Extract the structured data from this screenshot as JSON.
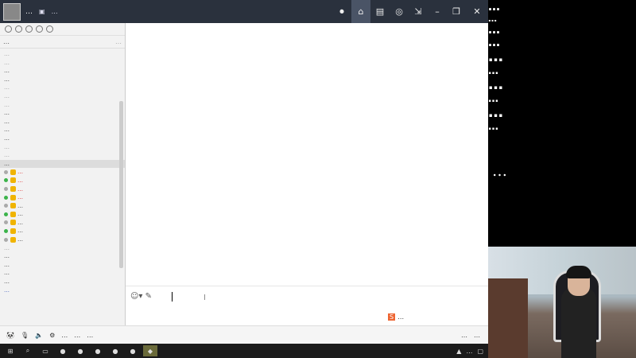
{
  "titlebar": {
    "user_name": "…",
    "user_id_icon": "id-card-icon",
    "followers": "…",
    "controls": [
      "home-icon",
      "layout-icon",
      "gamepad-icon",
      "shrink-icon",
      "minimize-icon",
      "restore-icon",
      "close-icon"
    ]
  },
  "left_panel": {
    "mode_label": "…",
    "mode_hint": "…",
    "lines": [
      {
        "text": "…",
        "style": "g"
      },
      {
        "text": "…",
        "style": "g"
      },
      {
        "text": "…",
        "style": "b"
      },
      {
        "text": "…",
        "style": "b"
      },
      {
        "text": "…",
        "style": "g"
      },
      {
        "text": "…",
        "style": "g"
      },
      {
        "text": "…",
        "style": "g"
      },
      {
        "text": "…",
        "style": "b"
      },
      {
        "text": "…",
        "style": "b"
      },
      {
        "text": "…",
        "style": "b"
      },
      {
        "text": "…",
        "style": "b"
      },
      {
        "text": "…",
        "style": "g"
      },
      {
        "text": "…",
        "style": "g"
      },
      {
        "text": "…",
        "style": "hl"
      },
      {
        "text": "…",
        "style": "red"
      },
      {
        "text": "…",
        "style": "red"
      },
      {
        "text": "…",
        "style": "red"
      },
      {
        "text": "…",
        "style": "red"
      },
      {
        "text": "…",
        "style": "b"
      },
      {
        "text": "…",
        "style": "b"
      },
      {
        "text": "…",
        "style": "b"
      },
      {
        "text": "…",
        "style": "b"
      },
      {
        "text": "…",
        "style": "b"
      },
      {
        "text": "…",
        "style": "g"
      },
      {
        "text": "…",
        "style": "b"
      },
      {
        "text": "…",
        "style": "b"
      },
      {
        "text": "…",
        "style": "b"
      },
      {
        "text": "…",
        "style": "b"
      },
      {
        "text": "…",
        "style": "blue"
      }
    ]
  },
  "input_bar": {
    "caret": "I",
    "ime_label": "…"
  },
  "bottom_bar": {
    "buttons": [
      "…",
      "…",
      "…"
    ],
    "right": [
      "…",
      "…"
    ]
  },
  "taskbar": {
    "clock": "…"
  },
  "overlay": {
    "lines": [
      {
        "text": "…",
        "cls": "big"
      },
      {
        "text": "…",
        "cls": "med"
      },
      {
        "text": "…",
        "cls": "big"
      },
      {
        "text": "…",
        "cls": "big"
      },
      {
        "text": "…",
        "cls": "huge"
      },
      {
        "text": "…",
        "cls": "sub"
      },
      {
        "text": "…",
        "cls": "huge"
      },
      {
        "text": "…",
        "cls": "sub"
      },
      {
        "text": "…",
        "cls": "huge"
      },
      {
        "text": "…",
        "cls": "sub"
      }
    ],
    "slogan": "…"
  }
}
